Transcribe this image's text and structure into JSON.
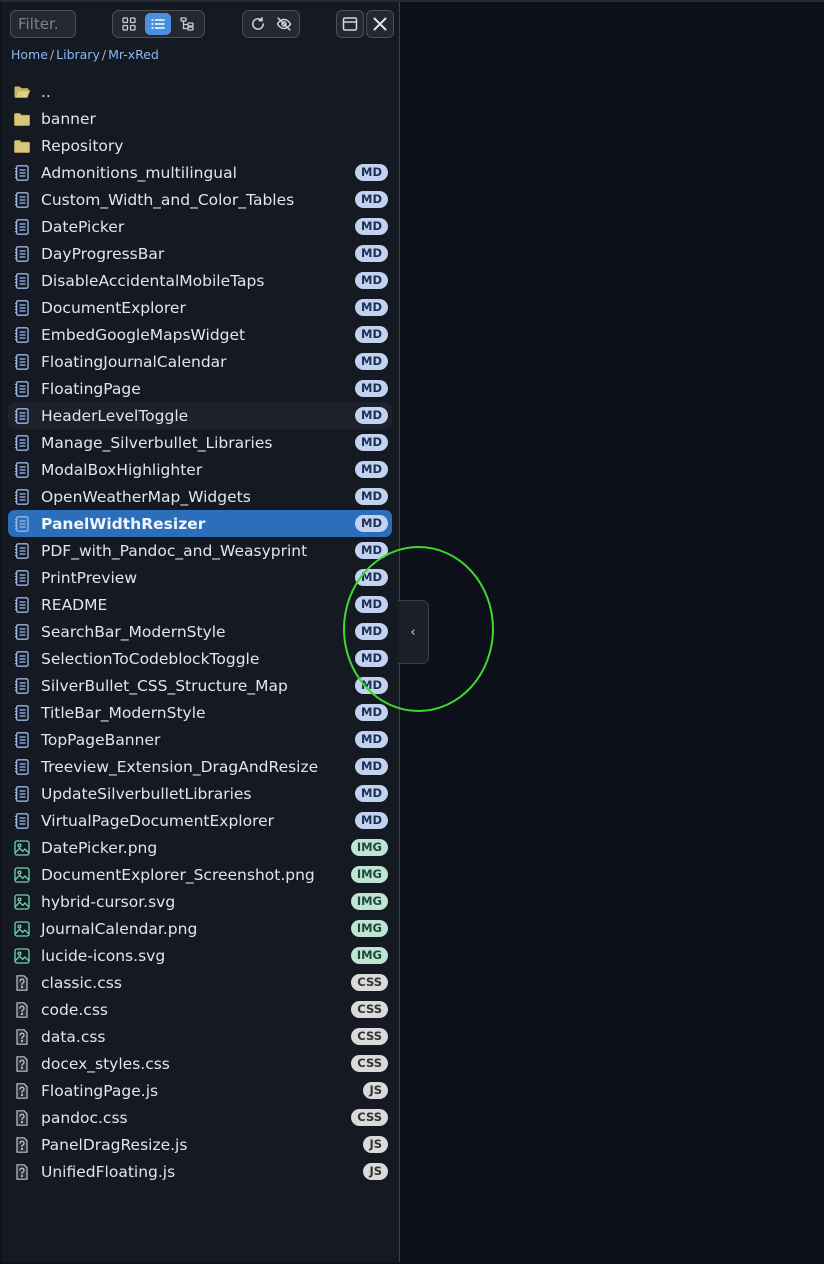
{
  "toolbar": {
    "filter_placeholder": "Filter.",
    "view_buttons": [
      "grid-view",
      "list-view",
      "tree-view"
    ],
    "active_view": "list-view"
  },
  "breadcrumb": [
    "Home",
    "Library",
    "Mr-xRed"
  ],
  "collapse_label": "‹",
  "colors": {
    "accent": "#4a8fe0",
    "selected_row": "#2b6fba",
    "highlight_ring": "#3ed82e"
  },
  "items": [
    {
      "name": "..",
      "type": "folder-open",
      "badge": ""
    },
    {
      "name": "banner",
      "type": "folder",
      "badge": ""
    },
    {
      "name": "Repository",
      "type": "folder",
      "badge": ""
    },
    {
      "name": "Admonitions_multilingual",
      "type": "page",
      "badge": "MD"
    },
    {
      "name": "Custom_Width_and_Color_Tables",
      "type": "page",
      "badge": "MD"
    },
    {
      "name": "DatePicker",
      "type": "page",
      "badge": "MD"
    },
    {
      "name": "DayProgressBar",
      "type": "page",
      "badge": "MD"
    },
    {
      "name": "DisableAccidentalMobileTaps",
      "type": "page",
      "badge": "MD"
    },
    {
      "name": "DocumentExplorer",
      "type": "page",
      "badge": "MD"
    },
    {
      "name": "EmbedGoogleMapsWidget",
      "type": "page",
      "badge": "MD"
    },
    {
      "name": "FloatingJournalCalendar",
      "type": "page",
      "badge": "MD"
    },
    {
      "name": "FloatingPage",
      "type": "page",
      "badge": "MD"
    },
    {
      "name": "HeaderLevelToggle",
      "type": "page",
      "badge": "MD",
      "state": "hover"
    },
    {
      "name": "Manage_Silverbullet_Libraries",
      "type": "page",
      "badge": "MD"
    },
    {
      "name": "ModalBoxHighlighter",
      "type": "page",
      "badge": "MD"
    },
    {
      "name": "OpenWeatherMap_Widgets",
      "type": "page",
      "badge": "MD"
    },
    {
      "name": "PanelWidthResizer",
      "type": "page",
      "badge": "MD",
      "state": "selected"
    },
    {
      "name": "PDF_with_Pandoc_and_Weasyprint",
      "type": "page",
      "badge": "MD"
    },
    {
      "name": "PrintPreview",
      "type": "page",
      "badge": "MD"
    },
    {
      "name": "README",
      "type": "page",
      "badge": "MD"
    },
    {
      "name": "SearchBar_ModernStyle",
      "type": "page",
      "badge": "MD"
    },
    {
      "name": "SelectionToCodeblockToggle",
      "type": "page",
      "badge": "MD"
    },
    {
      "name": "SilverBullet_CSS_Structure_Map",
      "type": "page",
      "badge": "MD"
    },
    {
      "name": "TitleBar_ModernStyle",
      "type": "page",
      "badge": "MD"
    },
    {
      "name": "TopPageBanner",
      "type": "page",
      "badge": "MD"
    },
    {
      "name": "Treeview_Extension_DragAndResize",
      "type": "page",
      "badge": "MD"
    },
    {
      "name": "UpdateSilverbulletLibraries",
      "type": "page",
      "badge": "MD"
    },
    {
      "name": "VirtualPageDocumentExplorer",
      "type": "page",
      "badge": "MD"
    },
    {
      "name": "DatePicker.png",
      "type": "image",
      "badge": "IMG"
    },
    {
      "name": "DocumentExplorer_Screenshot.png",
      "type": "image",
      "badge": "IMG"
    },
    {
      "name": "hybrid-cursor.svg",
      "type": "image",
      "badge": "IMG"
    },
    {
      "name": "JournalCalendar.png",
      "type": "image",
      "badge": "IMG"
    },
    {
      "name": "lucide-icons.svg",
      "type": "image",
      "badge": "IMG"
    },
    {
      "name": "classic.css",
      "type": "unknown",
      "badge": "CSS"
    },
    {
      "name": "code.css",
      "type": "unknown",
      "badge": "CSS"
    },
    {
      "name": "data.css",
      "type": "unknown",
      "badge": "CSS"
    },
    {
      "name": "docex_styles.css",
      "type": "unknown",
      "badge": "CSS"
    },
    {
      "name": "FloatingPage.js",
      "type": "unknown",
      "badge": "JS"
    },
    {
      "name": "pandoc.css",
      "type": "unknown",
      "badge": "CSS"
    },
    {
      "name": "PanelDragResize.js",
      "type": "unknown",
      "badge": "JS"
    },
    {
      "name": "UnifiedFloating.js",
      "type": "unknown",
      "badge": "JS"
    }
  ]
}
